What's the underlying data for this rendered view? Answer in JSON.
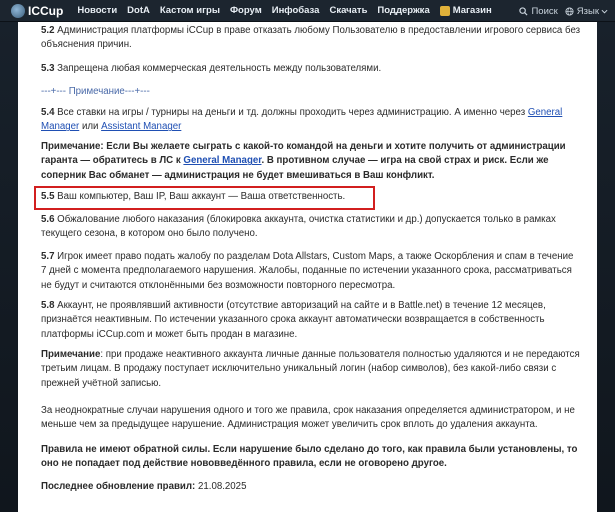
{
  "header": {
    "logo": "ICCup",
    "nav": [
      "Новости",
      "DotA",
      "Кастом игры",
      "Форум",
      "Инфобаза",
      "Скачать",
      "Поддержка"
    ],
    "shop": "Магазин",
    "search": "Поиск",
    "language": "Язык"
  },
  "content": {
    "p52_num": "5.2",
    "p52_text": " Администрация платформы  iCCup в праве отказать любому Пользователю в предоставлении игрового сервиса без объяснения причин.",
    "p53_num": "5.3",
    "p53_text": " Запрещена любая коммерческая деятельность между пользователями.",
    "note_sep": "---+--- Примечание---+---",
    "p54_num": "5.4",
    "p54_text1": " Все ставки на игры / турниры на деньги и тд. должны проходить через администрацию. А именно через ",
    "p54_link1": "General Manager",
    "p54_text2": " или ",
    "p54_link2": "Assistant Manager",
    "note_label": "Примечание",
    "note_text1": ": Если Вы желаете сыграть с какой-то командой на деньги и хотите получить от администрации гаранта — обратитесь в ЛС к ",
    "note_link": "General Manager",
    "note_text2": ". В противном случае — игра на свой страх и риск. Если же соперник Вас обманет — администрация не будет вмешиваться в Ваш конфликт.",
    "p55_num": "5.5",
    "p55_text": " Ваш компьютер, Ваш IP, Ваш аккаунт — Ваша ответственность.",
    "p56_num": "5.6",
    "p56_text": " Обжалование любого наказания (блокировка аккаунта, очистка статистики и др.) допускается только в рамках текущего сезона, в котором оно было получено.",
    "p57_num": "5.7",
    "p57_text": " Игрок имеет право подать жалобу по разделам Dota Allstars, Custom Maps, а также Оскорбления и спам в течение 7 дней с момента предполагаемого нарушения. Жалобы, поданные по истечении указанного срока, рассматриваться не будут и считаются отклонёнными без возможности повторного пересмотра.",
    "p58_num": "5.8",
    "p58_text": " Аккаунт, не проявлявший активности (отсутствие авторизаций на сайте и в Battle.net) в течение 12 месяцев, признаётся неактивным. По истечении указанного срока аккаунт автоматически возвращается в собственность платформы iCCup.com и может быть продан в магазине.",
    "note2_label": "Примечание",
    "note2_text": ": при продаже неактивного аккаунта личные данные пользователя полностью удаляются и не передаются третьим лицам. В продажу поступает исключительно уникальный логин (набор символов), без какой-либо связи с прежней учётной записью.",
    "repeat_text": "За неоднократные случаи нарушения одного и того же правила, срок наказания определяется администратором, и не меньше чем за предыдущее нарушение. Администрация может увеличить срок вплоть до удаления аккаунта.",
    "final_bold": "Правила не имеют обратной силы. Если нарушение было сделано до того, как правила были установлены, то оно не попадает под действие нововведённого правила, если не оговорено другое.",
    "updated_label": "Последнее обновление правил:",
    "updated_date": " 21.08.2025"
  },
  "colors": {
    "header_bg": "#1c252f",
    "link": "#1f4fb3",
    "highlight_border": "#d21f1f",
    "note_sep": "#4a6aa8"
  },
  "icons": [
    "logo-icon",
    "shop-icon",
    "search-icon",
    "globe-icon",
    "chevron-down-icon"
  ]
}
